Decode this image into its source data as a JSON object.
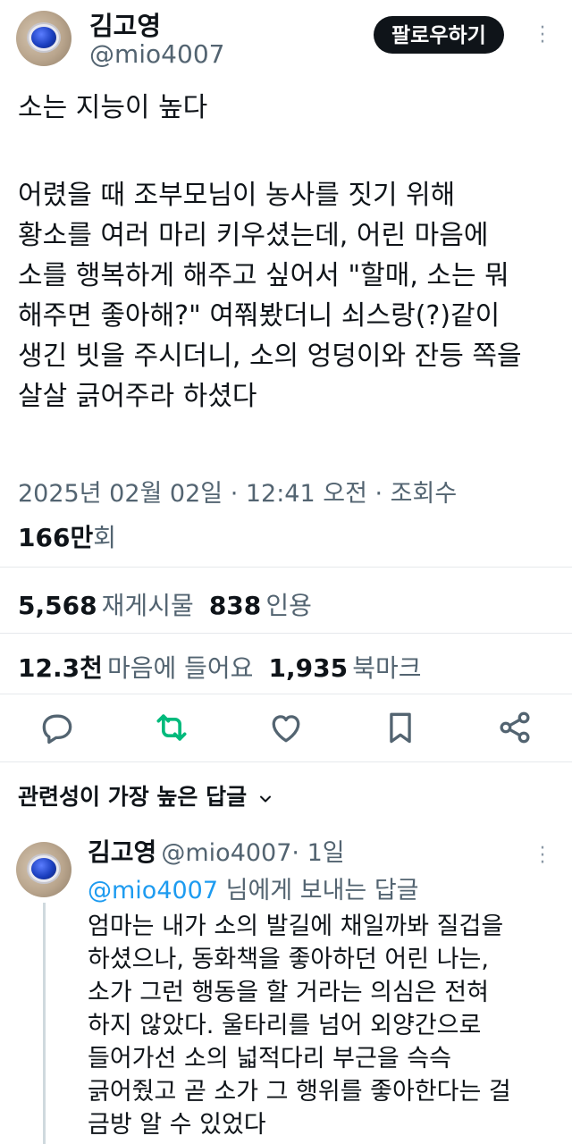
{
  "post": {
    "author_name": "김고영",
    "author_handle": "@mio4007",
    "follow_label": "팔로우하기",
    "title_line": "소는 지능이 높다",
    "body": "어렸을 때 조부모님이 농사를 짓기 위해\n황소를 여러 마리 키우셨는데, 어린 마음에\n소를 행복하게 해주고 싶어서 \"할매, 소는 뭐\n해주면 좋아해?\" 여쭤봤더니 쇠스랑(?)같이\n생긴 빗을 주시더니, 소의 엉덩이와 잔등 쪽을\n살살 긁어주라 하셨다",
    "timestamp": "2025년 02월 02일 · 12:41 오전 · 조회수",
    "views_num": "166만",
    "views_suffix": "회"
  },
  "stats": {
    "reposts_num": "5,568",
    "reposts_label": "재게시물",
    "quotes_num": "838",
    "quotes_label": "인용",
    "likes_num": "12.3천",
    "likes_label": "마음에 들어요",
    "bookmarks_num": "1,935",
    "bookmarks_label": "북마크"
  },
  "actions": {
    "icons": [
      "reply-icon",
      "repost-icon",
      "like-icon",
      "bookmark-icon",
      "share-icon"
    ],
    "repost_color": "#00ba7c",
    "default_color": "#536471"
  },
  "replies_header": {
    "label": "관련성이 가장 높은 답글"
  },
  "reply": {
    "author_name": "김고영",
    "author_handle": "@mio4007",
    "time": "· 1일",
    "to_handle": "@mio4007",
    "to_suffix": " 님에게 보내는 답글",
    "body": "엄마는 내가 소의 발길에 채일까봐 질겁을\n하셨으나, 동화책을 좋아하던 어린 나는,\n소가 그런 행동을 할 거라는 의심은 전혀\n하지 않았다. 울타리를 넘어 외양간으로\n들어가선 소의 넓적다리 부근을 슥슥\n긁어줬고 곧 소가 그 행위를 좋아한다는 걸\n금방 알 수 있었다"
  },
  "colors": {
    "link": "#1d9bf0",
    "text": "#0f1419",
    "muted": "#536471"
  }
}
